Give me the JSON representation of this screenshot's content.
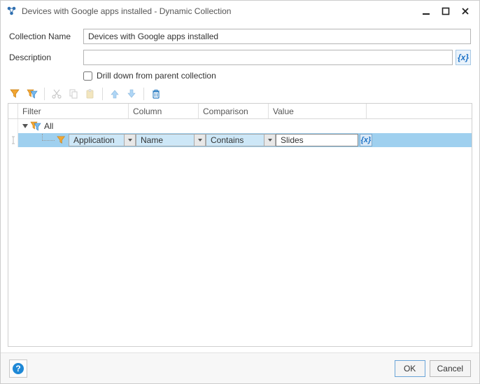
{
  "window": {
    "title": "Devices with Google apps installed - Dynamic Collection"
  },
  "form": {
    "collection_name_label": "Collection Name",
    "collection_name_value": "Devices with Google apps installed",
    "description_label": "Description",
    "description_value": "",
    "drill_down_label": "Drill down from parent collection",
    "drill_down_checked": false
  },
  "toolbar": {
    "icons": {
      "add_filter": "add-filter-icon",
      "add_group": "add-group-icon",
      "cut": "cut-icon",
      "copy": "copy-icon",
      "paste": "paste-icon",
      "move_up": "arrow-up-icon",
      "move_down": "arrow-down-icon",
      "delete": "trash-icon"
    }
  },
  "grid": {
    "headers": {
      "filter": "Filter",
      "column": "Column",
      "comparison": "Comparison",
      "value": "Value"
    },
    "root": {
      "label": "All",
      "expanded": true
    },
    "rows": [
      {
        "filter": "Application",
        "column": "Name",
        "comparison": "Contains",
        "value": "Slides",
        "selected": true
      }
    ]
  },
  "footer": {
    "ok_label": "OK",
    "cancel_label": "Cancel"
  },
  "icons": {
    "expression": "{x}"
  }
}
